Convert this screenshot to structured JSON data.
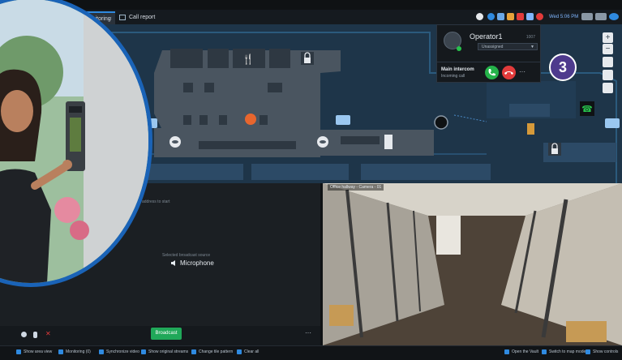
{
  "tabs": [
    {
      "label": "Monitoring",
      "active": true
    },
    {
      "label": "Call report",
      "active": false
    }
  ],
  "tab_close": "×",
  "clock": "Wed 5:06 PM",
  "operator": {
    "name": "Operator1",
    "id": "1007",
    "status_select": "Unassigned",
    "call_title": "Main intercom",
    "call_subtitle": "Incoming call",
    "more": "···"
  },
  "badge": "3",
  "map_controls": [
    "+",
    "−"
  ],
  "broadcast": {
    "hint": "address to start",
    "source_label": "Selected broadcast source",
    "source_value": "Microphone",
    "button": "Broadcast",
    "more": "···"
  },
  "camera": {
    "title": "Office hallway - Camera - 01"
  },
  "bottom_left": [
    {
      "label": "Show area view",
      "icon": "area-view-icon"
    },
    {
      "label": "Monitoring (0)",
      "icon": "monitoring-icon"
    },
    {
      "label": "Synchronize video",
      "icon": "sync-icon"
    },
    {
      "label": "Show original streams",
      "icon": "streams-icon"
    },
    {
      "label": "Change tile pattern",
      "icon": "tile-pattern-icon"
    },
    {
      "label": "Clear all",
      "icon": "clear-all-icon"
    }
  ],
  "bottom_right": [
    {
      "label": "Open the Vault",
      "icon": "vault-icon"
    },
    {
      "label": "Switch to map mode",
      "icon": "map-mode-icon"
    },
    {
      "label": "Show controls",
      "icon": "controls-icon"
    }
  ],
  "colors": {
    "accent": "#2f8ae0",
    "answer": "#25b34a",
    "hangup": "#e23b3b",
    "badge": "#4e3a8d",
    "photo_border": "#1a63b7",
    "broadcast": "#20a859"
  }
}
